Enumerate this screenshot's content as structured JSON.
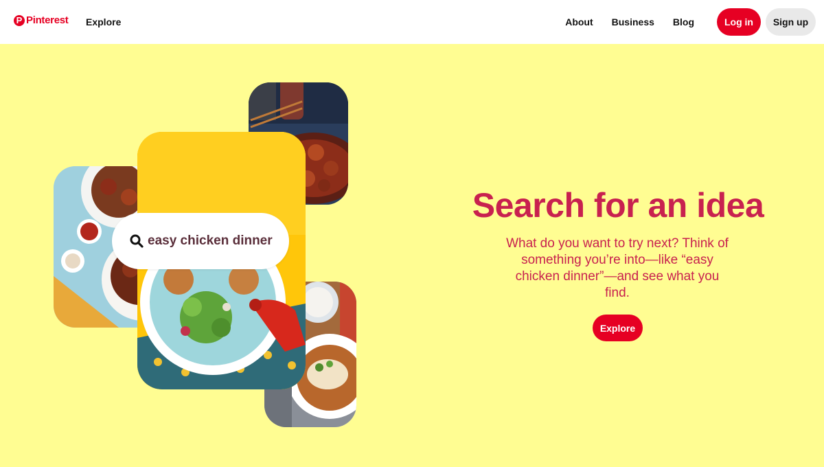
{
  "header": {
    "logo_text": "Pinterest",
    "logo_letter": "P",
    "nav_explore": "Explore",
    "links": [
      "About",
      "Business",
      "Blog"
    ],
    "login_label": "Log in",
    "signup_label": "Sign up"
  },
  "hero": {
    "search_query": "easy chicken dinner",
    "title": "Search for an idea",
    "description": "What do you want to try next? Think of something you’re into—like “easy chicken dinner”—and see what you find.",
    "explore_label": "Explore"
  },
  "colors": {
    "brand_red": "#e60023",
    "hero_background": "#fffd92",
    "hero_text": "#c8214f"
  }
}
